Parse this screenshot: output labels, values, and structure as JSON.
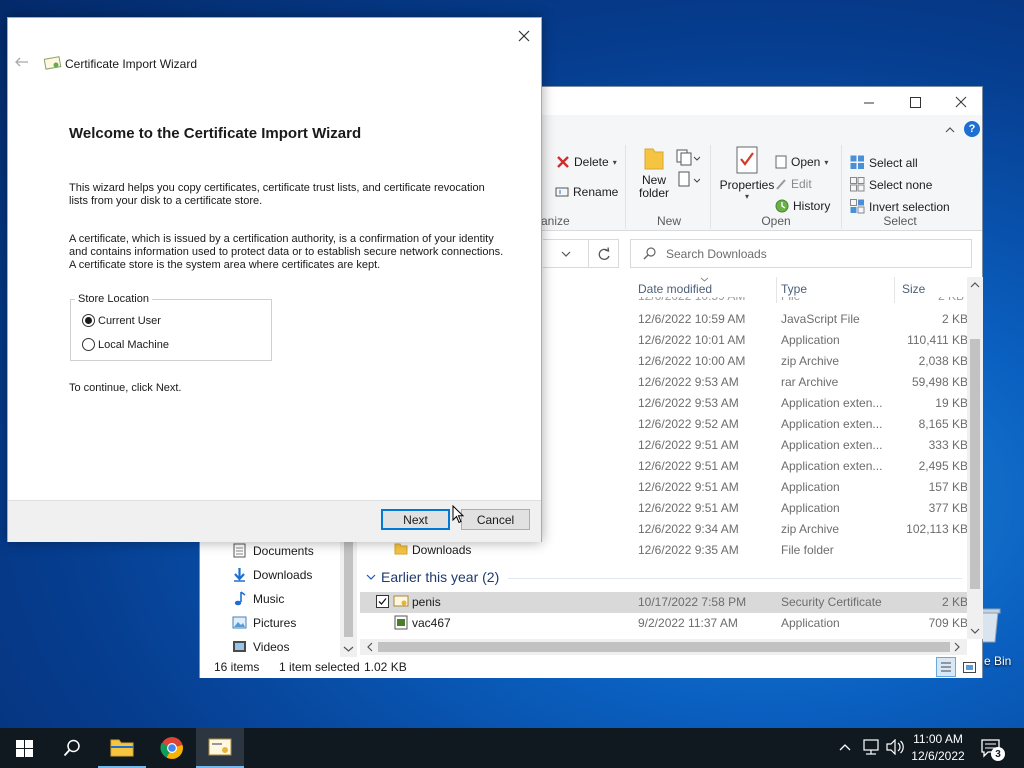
{
  "desktop": {
    "recycle_bin_label": "e Bin"
  },
  "explorer": {
    "ribbon": {
      "organize_group": {
        "label": "anize",
        "delete": "Delete",
        "rename": "Rename"
      },
      "new_group": {
        "label": "New",
        "new_folder_line1": "New",
        "new_folder_line2": "folder"
      },
      "open_group": {
        "label": "Open",
        "properties": "Properties",
        "open": "Open",
        "edit": "Edit",
        "history": "History"
      },
      "select_group": {
        "label": "Select",
        "select_all": "Select all",
        "select_none": "Select none",
        "invert_selection": "Invert selection"
      }
    },
    "search": {
      "placeholder": "Search Downloads"
    },
    "columns": {
      "date_modified": "Date modified",
      "type": "Type",
      "size": "Size"
    },
    "files": [
      {
        "date": "12/6/2022 10:59 AM",
        "type": "JavaScript File",
        "size": "2 KB"
      },
      {
        "date": "12/6/2022 10:01 AM",
        "type": "Application",
        "size": "110,411 KB"
      },
      {
        "date": "12/6/2022 10:00 AM",
        "type": "zip Archive",
        "size": "2,038 KB"
      },
      {
        "date": "12/6/2022 9:53 AM",
        "type": "rar Archive",
        "size": "59,498 KB"
      },
      {
        "date": "12/6/2022 9:53 AM",
        "type": "Application exten...",
        "size": "19 KB"
      },
      {
        "date": "12/6/2022 9:52 AM",
        "type": "Application exten...",
        "size": "8,165 KB"
      },
      {
        "date": "12/6/2022 9:51 AM",
        "type": "Application exten...",
        "size": "333 KB"
      },
      {
        "date": "12/6/2022 9:51 AM",
        "type": "Application exten...",
        "size": "2,495 KB"
      },
      {
        "date": "12/6/2022 9:51 AM",
        "type": "Application",
        "size": "157 KB"
      },
      {
        "date": "12/6/2022 9:51 AM",
        "type": "Application",
        "size": "377 KB"
      },
      {
        "date": "12/6/2022 9:34 AM",
        "type": "zip Archive",
        "size": "102,113 KB"
      }
    ],
    "downloads_folder": {
      "name": "Downloads",
      "date": "12/6/2022 9:35 AM",
      "type": "File folder"
    },
    "group_header": "Earlier this year (2)",
    "earlier_files": [
      {
        "name": "penis",
        "date": "10/17/2022 7:58 PM",
        "type": "Security Certificate",
        "size": "2 KB"
      },
      {
        "name": "vac467",
        "date": "9/2/2022 11:37 AM",
        "type": "Application",
        "size": "709 KB"
      }
    ],
    "nav": [
      "Documents",
      "Downloads",
      "Music",
      "Pictures",
      "Videos"
    ],
    "status": {
      "items": "16 items",
      "selected": "1 item selected",
      "size": "1.02 KB"
    }
  },
  "wizard": {
    "title": "Certificate Import Wizard",
    "heading": "Welcome to the Certificate Import Wizard",
    "para1": "This wizard helps you copy certificates, certificate trust lists, and certificate revocation lists from your disk to a certificate store.",
    "para2": "A certificate, which is issued by a certification authority, is a confirmation of your identity and contains information used to protect data or to establish secure network connections. A certificate store is the system area where certificates are kept.",
    "store_location_label": "Store Location",
    "options": [
      "Current User",
      "Local Machine"
    ],
    "selected_option": "Current User",
    "continue_text": "To continue, click Next.",
    "next_button": "Next",
    "cancel_button": "Cancel"
  },
  "taskbar": {
    "time": "11:00 AM",
    "date": "12/6/2022",
    "notification_count": "3"
  },
  "colors": {
    "accent": "#0078d7",
    "desktop_blue": "#0a5fbf",
    "taskbar": "#101820",
    "selection": "#d9d9d9"
  }
}
